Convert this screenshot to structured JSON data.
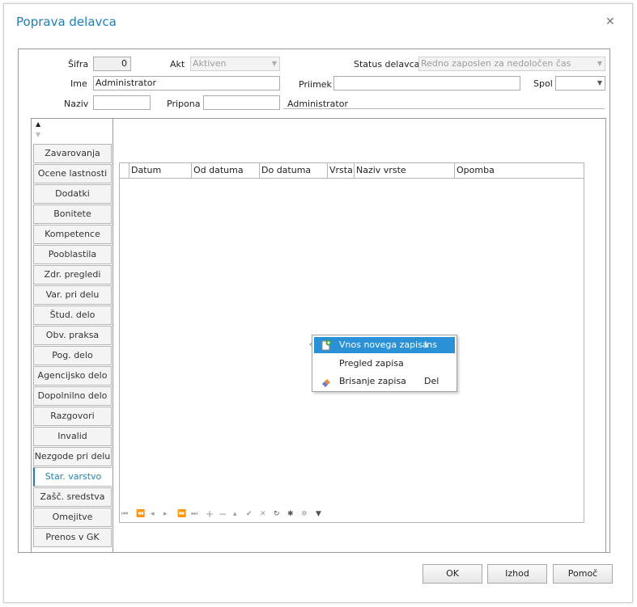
{
  "dialog": {
    "title": "Poprava delavca"
  },
  "form": {
    "sifra_label": "Šifra",
    "sifra_value": "0",
    "akt_label": "Akt",
    "akt_value": "Aktiven",
    "status_label": "Status delavca",
    "status_value": "Redno zaposlen za nedoločen čas",
    "ime_label": "Ime",
    "ime_value": "Administrator",
    "priimek_label": "Priimek",
    "priimek_value": "",
    "spol_label": "Spol",
    "spol_value": "",
    "naziv_label": "Naziv",
    "naziv_value": "",
    "pripona_label": "Pripona",
    "pripona_value": "",
    "display_name": "Administrator"
  },
  "tabs": [
    {
      "label": "Zavarovanja"
    },
    {
      "label": "Ocene lastnosti"
    },
    {
      "label": "Dodatki"
    },
    {
      "label": "Bonitete"
    },
    {
      "label": "Kompetence"
    },
    {
      "label": "Pooblastila"
    },
    {
      "label": "Zdr. pregledi"
    },
    {
      "label": "Var. pri delu"
    },
    {
      "label": "Štud. delo"
    },
    {
      "label": "Obv. praksa"
    },
    {
      "label": "Pog. delo"
    },
    {
      "label": "Agencijsko delo"
    },
    {
      "label": "Dopolnilno delo"
    },
    {
      "label": "Razgovori"
    },
    {
      "label": "Invalid"
    },
    {
      "label": "Nezgode pri delu"
    },
    {
      "label": "Star. varstvo"
    },
    {
      "label": "Zašč. sredstva"
    },
    {
      "label": "Omejitve"
    },
    {
      "label": "Prenos v GK"
    }
  ],
  "active_tab": "Star. varstvo",
  "grid": {
    "columns": [
      "Datum",
      "Od datuma",
      "Do datuma",
      "Vrsta",
      "Naziv vrste",
      "Opomba"
    ]
  },
  "context_menu": {
    "items": [
      {
        "label": "Vnos novega zapisa",
        "shortcut": "Ins",
        "icon": "new-record-icon"
      },
      {
        "label": "Pregled zapisa",
        "shortcut": "",
        "icon": ""
      },
      {
        "label": "Brisanje zapisa",
        "shortcut": "Del",
        "icon": "eraser-icon"
      }
    ]
  },
  "buttons": {
    "ok": "OK",
    "exit": "Izhod",
    "help": "Pomoč"
  },
  "colors": {
    "accent": "#1e7fb8",
    "highlight": "#2b91d6"
  }
}
